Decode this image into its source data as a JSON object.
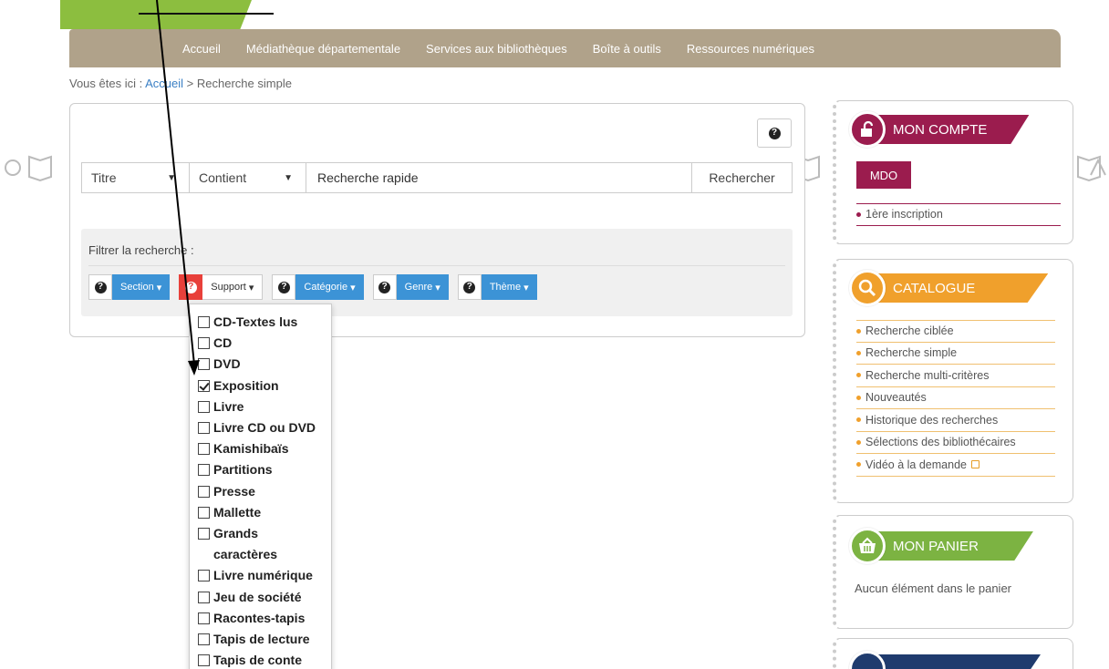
{
  "nav": {
    "items": [
      "Accueil",
      "Médiathèque départementale",
      "Services aux bibliothèques",
      "Boîte à outils",
      "Ressources numériques"
    ]
  },
  "breadcrumb": {
    "prefix": "Vous êtes ici :",
    "home": "Accueil",
    "separator": ">",
    "current": "Recherche simple"
  },
  "search": {
    "field_select": "Titre",
    "operator_select": "Contient",
    "input_value": "Recherche rapide",
    "submit_label": "Rechercher",
    "help_icon": "question-circle-icon"
  },
  "filters": {
    "label": "Filtrer la recherche :",
    "buttons": [
      {
        "label": "Section",
        "active": false
      },
      {
        "label": "Support",
        "active": true
      },
      {
        "label": "Catégorie",
        "active": false
      },
      {
        "label": "Genre",
        "active": false
      },
      {
        "label": "Thème",
        "active": false
      }
    ]
  },
  "support_options": [
    {
      "label": "CD-Textes lus",
      "checked": false
    },
    {
      "label": "CD",
      "checked": false
    },
    {
      "label": "DVD",
      "checked": false
    },
    {
      "label": "Exposition",
      "checked": true
    },
    {
      "label": "Livre",
      "checked": false
    },
    {
      "label": "Livre CD ou DVD",
      "checked": false
    },
    {
      "label": "Kamishibaïs",
      "checked": false
    },
    {
      "label": "Partitions",
      "checked": false
    },
    {
      "label": "Presse",
      "checked": false
    },
    {
      "label": "Mallette",
      "checked": false
    },
    {
      "label": "Grands caractères",
      "checked": false
    },
    {
      "label": "Livre numérique",
      "checked": false
    },
    {
      "label": "Jeu de société",
      "checked": false
    },
    {
      "label": "Racontes-tapis",
      "checked": false
    },
    {
      "label": "Tapis de lecture",
      "checked": false
    },
    {
      "label": "Tapis de conte",
      "checked": false
    }
  ],
  "sidebar": {
    "account": {
      "title": "MON COMPTE",
      "icon": "lock-icon",
      "color": "#9b1c4e",
      "button": "MDO",
      "links": [
        "1ère inscription"
      ]
    },
    "catalog": {
      "title": "CATALOGUE",
      "icon": "search-icon",
      "color": "#f0a02c",
      "links": [
        "Recherche ciblée",
        "Recherche simple",
        "Recherche multi-critères",
        "Nouveautés",
        "Historique des recherches",
        "Sélections des bibliothécaires",
        "Vidéo à la demande"
      ]
    },
    "basket": {
      "title": "MON PANIER",
      "icon": "basket-icon",
      "color": "#7cb342",
      "empty_text": "Aucun élément dans le panier"
    },
    "next_widget_color": "#1f3b6e"
  },
  "colors": {
    "nav_bg": "#b0a28a",
    "filter_blue": "#3c93d6",
    "filter_red": "#e8403a",
    "link_blue": "#3a7fc4"
  }
}
